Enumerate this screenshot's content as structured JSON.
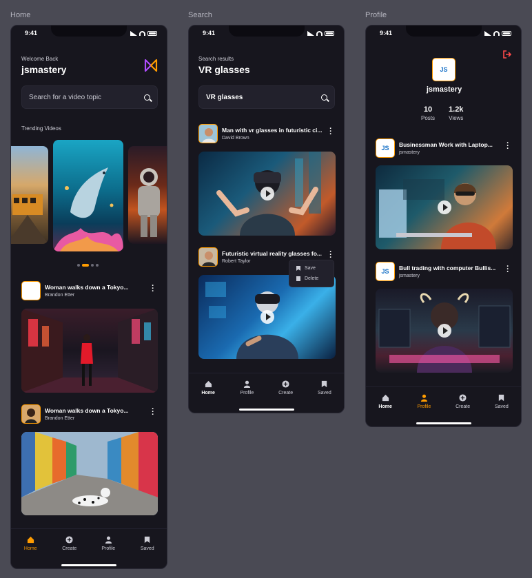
{
  "frames": {
    "home": {
      "label": "Home"
    },
    "search": {
      "label": "Search"
    },
    "profile": {
      "label": "Profile"
    }
  },
  "status": {
    "time": "9:41"
  },
  "home": {
    "welcome": "Welcome Back",
    "username": "jsmastery",
    "search_placeholder": "Search for a video topic",
    "trending_label": "Trending Videos",
    "videos": [
      {
        "title": "Woman walks down a Tokyo...",
        "creator": "Brandon Etter"
      },
      {
        "title": "Woman walks down a Tokyo...",
        "creator": "Brandon Etter"
      }
    ],
    "carousel_active_index": 1
  },
  "search": {
    "subtitle": "Search results",
    "query_title": "VR glasses",
    "input_value": "VR glasses",
    "videos": [
      {
        "title": "Man with vr glasses in futuristic ci...",
        "creator": "David Brown"
      },
      {
        "title": "Futuristic virtual reality glasses fo...",
        "creator": "Robert Taylor"
      }
    ],
    "menu": {
      "save": "Save",
      "delete": "Delete"
    }
  },
  "profile": {
    "username": "jsmastery",
    "logo_text": "JS",
    "stats": [
      {
        "value": "10",
        "label": "Posts"
      },
      {
        "value": "1.2k",
        "label": "Views"
      }
    ],
    "videos": [
      {
        "title": "Businessman Work with Laptop...",
        "creator": "jsmastery"
      },
      {
        "title": "Bull trading with computer Bullis...",
        "creator": "jsmastery"
      }
    ]
  },
  "tabs": {
    "home": "Home",
    "create": "Create",
    "profile": "Profile",
    "saved": "Saved"
  },
  "colors": {
    "accent": "#ff9c01",
    "background": "#17161e",
    "canvas": "#4a4a54"
  }
}
